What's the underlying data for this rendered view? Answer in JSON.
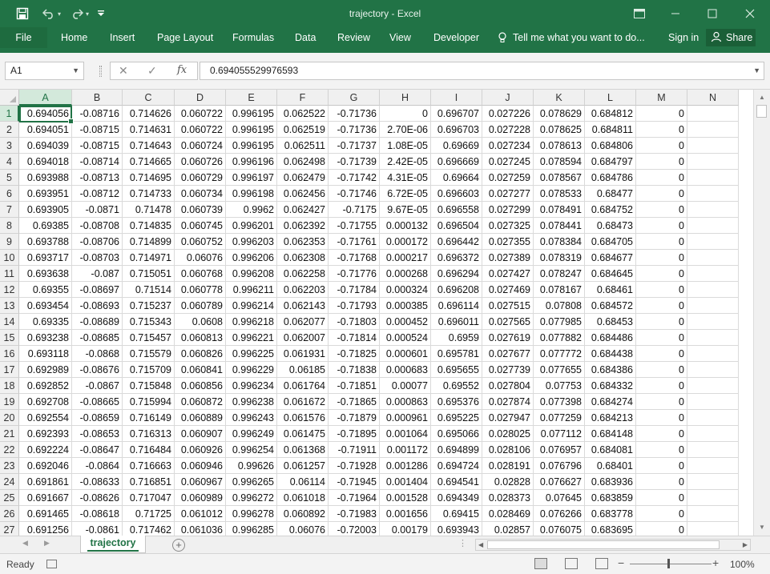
{
  "app": {
    "title": "trajectory - Excel"
  },
  "quick_access": {
    "save_icon": "save-icon",
    "undo_icon": "undo-icon",
    "redo_icon": "redo-icon"
  },
  "ribbon": {
    "tabs": [
      "File",
      "Home",
      "Insert",
      "Page Layout",
      "Formulas",
      "Data",
      "Review",
      "View",
      "Developer"
    ],
    "tell_me": "Tell me what you want to do...",
    "sign_in": "Sign in",
    "share": "Share"
  },
  "formula_bar": {
    "name_box": "A1",
    "fx_symbol": "fx",
    "formula_value": "0.694055529976593"
  },
  "columns": [
    "A",
    "B",
    "C",
    "D",
    "E",
    "F",
    "G",
    "H",
    "I",
    "J",
    "K",
    "L",
    "M",
    "N"
  ],
  "rows": [
    [
      "1",
      "0.694056",
      "-0.08716",
      "0.714626",
      "0.060722",
      "0.996195",
      "0.062522",
      "-0.71736",
      "0",
      "0.696707",
      "0.027226",
      "0.078629",
      "0.684812",
      "0"
    ],
    [
      "2",
      "0.694051",
      "-0.08715",
      "0.714631",
      "0.060722",
      "0.996195",
      "0.062519",
      "-0.71736",
      "2.70E-06",
      "0.696703",
      "0.027228",
      "0.078625",
      "0.684811",
      "0"
    ],
    [
      "3",
      "0.694039",
      "-0.08715",
      "0.714643",
      "0.060724",
      "0.996195",
      "0.062511",
      "-0.71737",
      "1.08E-05",
      "0.69669",
      "0.027234",
      "0.078613",
      "0.684806",
      "0"
    ],
    [
      "4",
      "0.694018",
      "-0.08714",
      "0.714665",
      "0.060726",
      "0.996196",
      "0.062498",
      "-0.71739",
      "2.42E-05",
      "0.696669",
      "0.027245",
      "0.078594",
      "0.684797",
      "0"
    ],
    [
      "5",
      "0.693988",
      "-0.08713",
      "0.714695",
      "0.060729",
      "0.996197",
      "0.062479",
      "-0.71742",
      "4.31E-05",
      "0.69664",
      "0.027259",
      "0.078567",
      "0.684786",
      "0"
    ],
    [
      "6",
      "0.693951",
      "-0.08712",
      "0.714733",
      "0.060734",
      "0.996198",
      "0.062456",
      "-0.71746",
      "6.72E-05",
      "0.696603",
      "0.027277",
      "0.078533",
      "0.68477",
      "0"
    ],
    [
      "7",
      "0.693905",
      "-0.0871",
      "0.71478",
      "0.060739",
      "0.9962",
      "0.062427",
      "-0.7175",
      "9.67E-05",
      "0.696558",
      "0.027299",
      "0.078491",
      "0.684752",
      "0"
    ],
    [
      "8",
      "0.69385",
      "-0.08708",
      "0.714835",
      "0.060745",
      "0.996201",
      "0.062392",
      "-0.71755",
      "0.000132",
      "0.696504",
      "0.027325",
      "0.078441",
      "0.68473",
      "0"
    ],
    [
      "9",
      "0.693788",
      "-0.08706",
      "0.714899",
      "0.060752",
      "0.996203",
      "0.062353",
      "-0.71761",
      "0.000172",
      "0.696442",
      "0.027355",
      "0.078384",
      "0.684705",
      "0"
    ],
    [
      "10",
      "0.693717",
      "-0.08703",
      "0.714971",
      "0.06076",
      "0.996206",
      "0.062308",
      "-0.71768",
      "0.000217",
      "0.696372",
      "0.027389",
      "0.078319",
      "0.684677",
      "0"
    ],
    [
      "11",
      "0.693638",
      "-0.087",
      "0.715051",
      "0.060768",
      "0.996208",
      "0.062258",
      "-0.71776",
      "0.000268",
      "0.696294",
      "0.027427",
      "0.078247",
      "0.684645",
      "0"
    ],
    [
      "12",
      "0.69355",
      "-0.08697",
      "0.71514",
      "0.060778",
      "0.996211",
      "0.062203",
      "-0.71784",
      "0.000324",
      "0.696208",
      "0.027469",
      "0.078167",
      "0.68461",
      "0"
    ],
    [
      "13",
      "0.693454",
      "-0.08693",
      "0.715237",
      "0.060789",
      "0.996214",
      "0.062143",
      "-0.71793",
      "0.000385",
      "0.696114",
      "0.027515",
      "0.07808",
      "0.684572",
      "0"
    ],
    [
      "14",
      "0.69335",
      "-0.08689",
      "0.715343",
      "0.0608",
      "0.996218",
      "0.062077",
      "-0.71803",
      "0.000452",
      "0.696011",
      "0.027565",
      "0.077985",
      "0.68453",
      "0"
    ],
    [
      "15",
      "0.693238",
      "-0.08685",
      "0.715457",
      "0.060813",
      "0.996221",
      "0.062007",
      "-0.71814",
      "0.000524",
      "0.6959",
      "0.027619",
      "0.077882",
      "0.684486",
      "0"
    ],
    [
      "16",
      "0.693118",
      "-0.0868",
      "0.715579",
      "0.060826",
      "0.996225",
      "0.061931",
      "-0.71825",
      "0.000601",
      "0.695781",
      "0.027677",
      "0.077772",
      "0.684438",
      "0"
    ],
    [
      "17",
      "0.692989",
      "-0.08676",
      "0.715709",
      "0.060841",
      "0.996229",
      "0.06185",
      "-0.71838",
      "0.000683",
      "0.695655",
      "0.027739",
      "0.077655",
      "0.684386",
      "0"
    ],
    [
      "18",
      "0.692852",
      "-0.0867",
      "0.715848",
      "0.060856",
      "0.996234",
      "0.061764",
      "-0.71851",
      "0.00077",
      "0.69552",
      "0.027804",
      "0.07753",
      "0.684332",
      "0"
    ],
    [
      "19",
      "0.692708",
      "-0.08665",
      "0.715994",
      "0.060872",
      "0.996238",
      "0.061672",
      "-0.71865",
      "0.000863",
      "0.695376",
      "0.027874",
      "0.077398",
      "0.684274",
      "0"
    ],
    [
      "20",
      "0.692554",
      "-0.08659",
      "0.716149",
      "0.060889",
      "0.996243",
      "0.061576",
      "-0.71879",
      "0.000961",
      "0.695225",
      "0.027947",
      "0.077259",
      "0.684213",
      "0"
    ],
    [
      "21",
      "0.692393",
      "-0.08653",
      "0.716313",
      "0.060907",
      "0.996249",
      "0.061475",
      "-0.71895",
      "0.001064",
      "0.695066",
      "0.028025",
      "0.077112",
      "0.684148",
      "0"
    ],
    [
      "22",
      "0.692224",
      "-0.08647",
      "0.716484",
      "0.060926",
      "0.996254",
      "0.061368",
      "-0.71911",
      "0.001172",
      "0.694899",
      "0.028106",
      "0.076957",
      "0.684081",
      "0"
    ],
    [
      "23",
      "0.692046",
      "-0.0864",
      "0.716663",
      "0.060946",
      "0.99626",
      "0.061257",
      "-0.71928",
      "0.001286",
      "0.694724",
      "0.028191",
      "0.076796",
      "0.68401",
      "0"
    ],
    [
      "24",
      "0.691861",
      "-0.08633",
      "0.716851",
      "0.060967",
      "0.996265",
      "0.06114",
      "-0.71945",
      "0.001404",
      "0.694541",
      "0.02828",
      "0.076627",
      "0.683936",
      "0"
    ],
    [
      "25",
      "0.691667",
      "-0.08626",
      "0.717047",
      "0.060989",
      "0.996272",
      "0.061018",
      "-0.71964",
      "0.001528",
      "0.694349",
      "0.028373",
      "0.07645",
      "0.683859",
      "0"
    ],
    [
      "26",
      "0.691465",
      "-0.08618",
      "0.71725",
      "0.061012",
      "0.996278",
      "0.060892",
      "-0.71983",
      "0.001656",
      "0.69415",
      "0.028469",
      "0.076266",
      "0.683778",
      "0"
    ],
    [
      "27",
      "0.691256",
      "-0.0861",
      "0.717462",
      "0.061036",
      "0.996285",
      "0.06076",
      "-0.72003",
      "0.00179",
      "0.693943",
      "0.02857",
      "0.076075",
      "0.683695",
      "0"
    ]
  ],
  "sheet_tabs": [
    "trajectory"
  ],
  "status": {
    "ready": "Ready",
    "zoom": "100%"
  }
}
